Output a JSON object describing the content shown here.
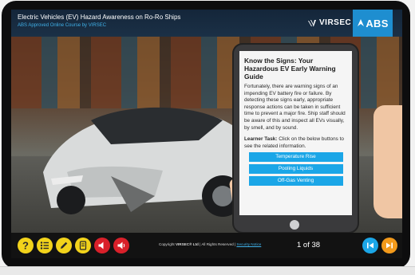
{
  "header": {
    "title": "Electric Vehicles (EV) Hazard Awareness on Ro-Ro Ships",
    "subtitle": "ABS Approved Online Course by VIRSEC",
    "brand_virsec": "VIRSEC",
    "brand_abs": "ABS"
  },
  "panel": {
    "title": "Know the Signs: Your Hazardous EV Early Warning Guide",
    "body": "Fortunately, there are warning signs of an impending EV battery fire or failure. By detecting these signs early, appropriate response actions can be taken in sufficient time to prevent a major fire. Ship staff should be aware of this and inspect all EVs visually, by smell, and by sound.",
    "task_label": "Learner Task:",
    "task_text": " Click on the below buttons to see the related information.",
    "buttons": [
      "Temperature Rise",
      "Pooling Liquids",
      "Off-Gas Venting"
    ]
  },
  "footer": {
    "copyright_prefix": "Copyright ",
    "company": "VIRSEC® Ltd",
    "rights": " | All Rights Reserved | ",
    "link": "Security Notice",
    "pager": "1 of 38"
  },
  "toolbar": {
    "icons": [
      "help-icon",
      "menu-list-icon",
      "pencil-icon",
      "notes-icon",
      "sound-icon",
      "sound-icon"
    ]
  },
  "colors": {
    "accent": "#1ba6e7",
    "yellow": "#f2d31b",
    "red": "#d9202a",
    "orange": "#f39a1b",
    "header_bg": "#14263a"
  }
}
